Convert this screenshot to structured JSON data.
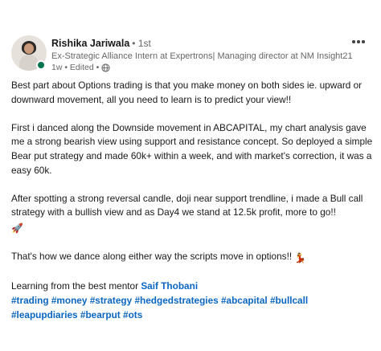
{
  "author": {
    "name": "Rishika Jariwala",
    "degree": "• 1st",
    "headline": "Ex-Strategic Alliance Intern at Expertrons| Managing director at NM Insight21",
    "meta": "1w • Edited •",
    "visibility_icon": "globe-icon"
  },
  "post": {
    "p1": "Best part about Options trading is that you make money on both sides ie. upward or downward movement, all you need to learn is to predict your view!!",
    "p2": "First i danced along the Downside movement in ABCAPITAL, my chart analysis gave me a strong bearish view using support and resistance concept. So deployed a simple Bear put strategy and made 60k+ within a week, and with market's correction, it was a easy 60k.",
    "p3": "After spotting a strong reversal candle, doji near support trendline, i made a Bull call strategy with a bullish view and as Day4 we stand at 12.5k profit, more to go!!",
    "p3_emoji": "🚀",
    "p4": "That's how we dance along either way the scripts move in options!!",
    "p4_emoji": "💃",
    "p5_prefix": "Learning from the best mentor",
    "mention": "Saif Thobani",
    "hashtags": [
      "#trading",
      "#money",
      "#strategy",
      "#hedgedstrategies",
      "#abcapital",
      "#bullcall",
      "#leapupdiaries",
      "#bearput",
      "#ots"
    ]
  },
  "colors": {
    "link": "#0a66c2",
    "online": "#01754f",
    "text": "#191919",
    "muted": "#666666"
  }
}
